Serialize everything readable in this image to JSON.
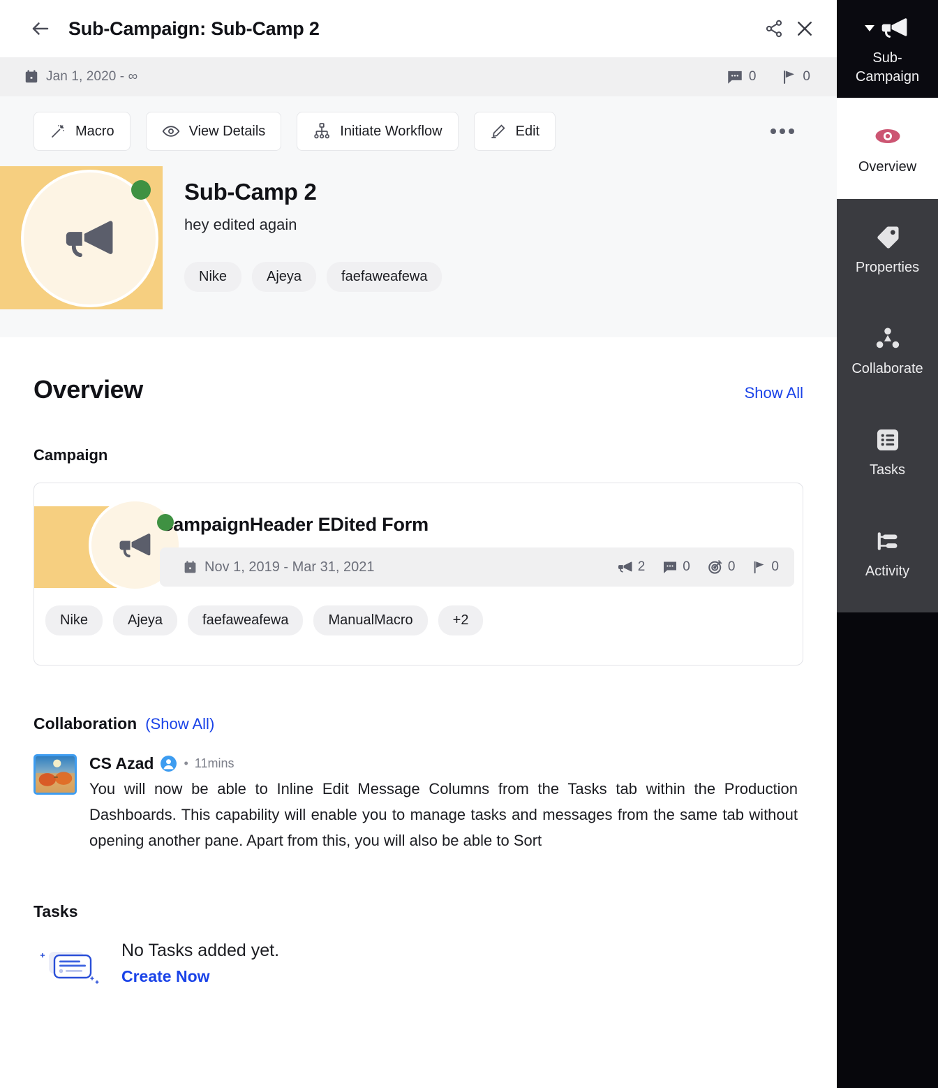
{
  "titlebar": {
    "back_icon": "back-arrow-icon",
    "title": "Sub-Campaign: Sub-Camp 2",
    "share_icon": "share-icon",
    "close_icon": "close-icon"
  },
  "datestrip": {
    "calendar_icon": "calendar-icon",
    "date_range": "Jan 1, 2020 - ∞",
    "stats": [
      {
        "icon": "comment-icon",
        "count": "0"
      },
      {
        "icon": "flag-icon",
        "count": "0"
      }
    ]
  },
  "actionbar": {
    "buttons": [
      {
        "icon": "magic-wand-icon",
        "label": "Macro"
      },
      {
        "icon": "eye-icon",
        "label": "View Details"
      },
      {
        "icon": "workflow-icon",
        "label": "Initiate Workflow"
      },
      {
        "icon": "pencil-icon",
        "label": "Edit"
      }
    ],
    "more_icon": "more-options-icon"
  },
  "hero": {
    "avatar_icon": "megaphone-icon",
    "status": "active",
    "status_color": "#3f9142",
    "banner_color": "#f6cf80",
    "avatar_bg": "#fdf4e4",
    "title": "Sub-Camp 2",
    "subtitle": "hey edited again",
    "tags": [
      "Nike",
      "Ajeya",
      "faefaweafewa"
    ]
  },
  "overview": {
    "title": "Overview",
    "show_all": "Show All",
    "campaign_section_title": "Campaign"
  },
  "campaign_card": {
    "avatar_icon": "megaphone-icon",
    "status_color": "#3f9142",
    "title": "CampaignHeader EDited Form",
    "calendar_icon": "calendar-icon",
    "date_range": "Nov 1, 2019 - Mar 31, 2021",
    "stats": [
      {
        "icon": "megaphone-icon",
        "count": "2"
      },
      {
        "icon": "comment-icon",
        "count": "0"
      },
      {
        "icon": "target-icon",
        "count": "0"
      },
      {
        "icon": "flag-icon",
        "count": "0"
      }
    ],
    "tags": [
      "Nike",
      "Ajeya",
      "faefaweafewa",
      "ManualMacro",
      "+2"
    ]
  },
  "collaboration": {
    "title": "Collaboration",
    "show_all": "(Show All)",
    "post": {
      "thumbnail_icon": "sunglasses-beach-thumbnail",
      "author": "CS Azad",
      "author_badge_icon": "user-badge-icon",
      "separator": "•",
      "time": "11mins",
      "message": "You will now be able to Inline Edit Message Columns from the Tasks tab within the Production Dashboards. This capability will enable you to manage tasks and messages from the same tab without opening another pane. Apart from this, you will also be able to Sort"
    }
  },
  "tasks": {
    "title": "Tasks",
    "empty_icon": "empty-tasks-illustration",
    "empty_text": "No Tasks added yet.",
    "create_link": "Create Now"
  },
  "sidebar": {
    "header": {
      "icon": "megaphone-icon",
      "caret_icon": "chevron-down-icon",
      "label": "Sub-Campaign"
    },
    "items": [
      {
        "icon": "eye-icon",
        "label": "Overview",
        "active": true,
        "accent": "#cc5572"
      },
      {
        "icon": "tag-icon",
        "label": "Properties",
        "active": false
      },
      {
        "icon": "collaborate-icon",
        "label": "Collaborate",
        "active": false
      },
      {
        "icon": "tasks-list-icon",
        "label": "Tasks",
        "active": false
      },
      {
        "icon": "activity-icon",
        "label": "Activity",
        "active": false
      }
    ]
  },
  "colors": {
    "link": "#1a43e8",
    "accent_red": "#cc5572",
    "status_green": "#3f9142",
    "banner_orange": "#f6cf80"
  }
}
